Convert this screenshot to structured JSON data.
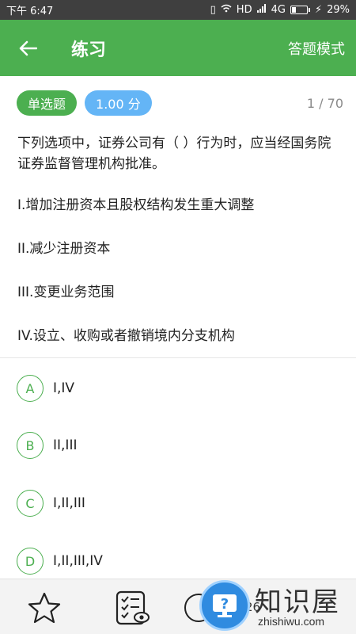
{
  "status_bar": {
    "time": "下午 6:47",
    "network": "HD",
    "signal": "4G",
    "battery": "29%"
  },
  "header": {
    "title": "练习",
    "mode_button": "答题模式"
  },
  "question_meta": {
    "type": "单选题",
    "score": "1.00 分",
    "progress": "1 / 70"
  },
  "question": {
    "text": "下列选项中，证券公司有（  ）行为时，应当经国务院证券监督管理机构批准。",
    "statements": [
      "I.增加注册资本且股权结构发生重大调整",
      "II.减少注册资本",
      "III.变更业务范围",
      "IV.设立、收购或者撤销境内分支机构"
    ]
  },
  "options": [
    {
      "letter": "A",
      "text": "I,IV"
    },
    {
      "letter": "B",
      "text": "II,III"
    },
    {
      "letter": "C",
      "text": "I,II,III"
    },
    {
      "letter": "D",
      "text": "I,II,III,IV"
    }
  ],
  "bottom_bar": {
    "count": "26"
  },
  "watermark": {
    "title": "知识屋",
    "url": "zhishiwu.com"
  },
  "colors": {
    "accent": "#4caf50",
    "score_tag": "#64b5f6",
    "status_bar": "#3f3f3f"
  }
}
